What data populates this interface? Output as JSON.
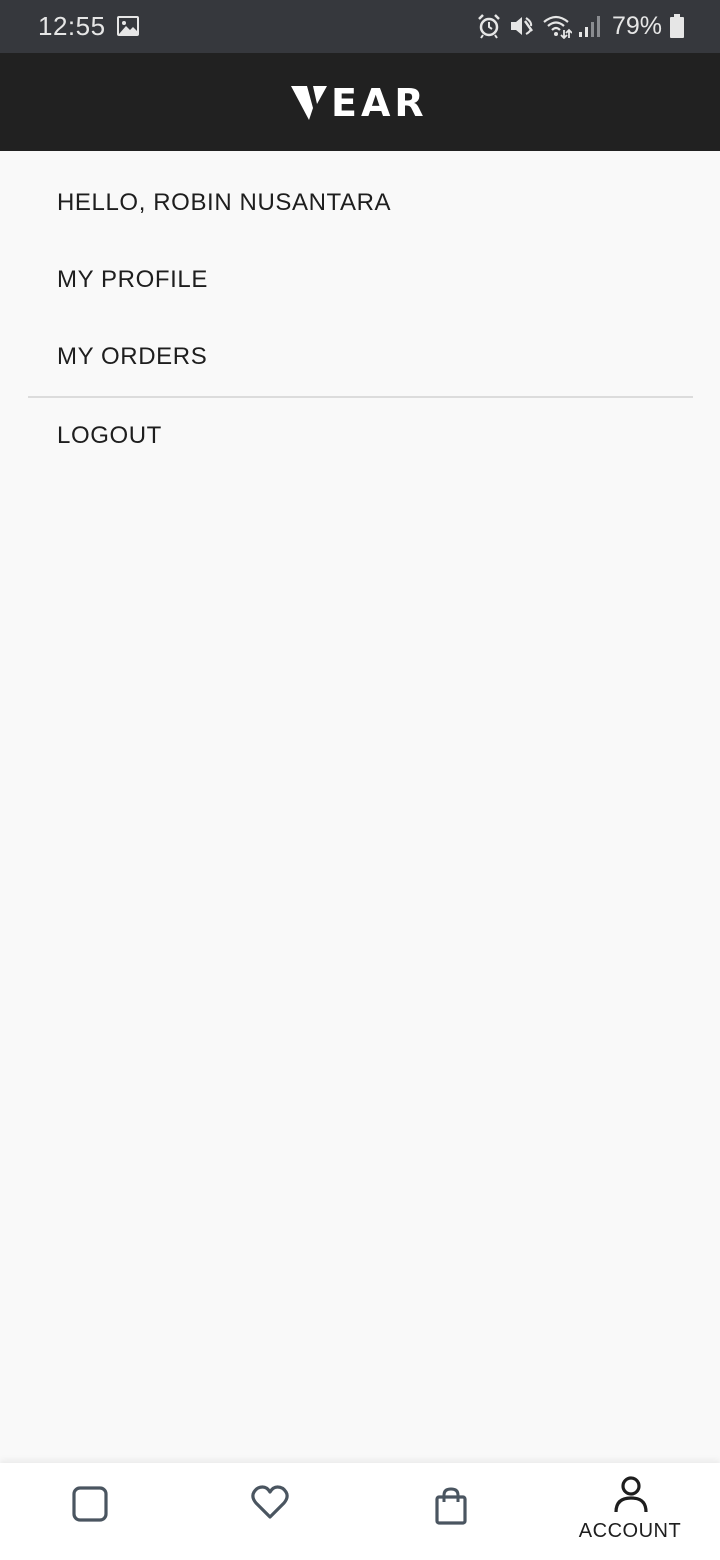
{
  "status_bar": {
    "time": "12:55",
    "battery_percent": "79%",
    "icons": [
      "image-icon",
      "alarm-icon",
      "mute-icon",
      "wifi-icon",
      "signal-icon",
      "battery-icon"
    ]
  },
  "header": {
    "logo_text": "EAR",
    "logo_name": "VEAR"
  },
  "menu": {
    "greeting": "HELLO, ROBIN NUSANTARA",
    "items": [
      {
        "label": "MY PROFILE"
      },
      {
        "label": "MY ORDERS"
      }
    ],
    "logout_label": "LOGOUT"
  },
  "bottom_nav": {
    "items": [
      {
        "icon": "square-home-icon",
        "label": ""
      },
      {
        "icon": "heart-icon",
        "label": ""
      },
      {
        "icon": "shopping-bag-icon",
        "label": ""
      },
      {
        "icon": "person-icon",
        "label": "ACCOUNT",
        "active": true
      }
    ],
    "icon_color": "#4a5560",
    "active_color": "#1e1e1e"
  },
  "colors": {
    "status_bar_bg": "#36383d",
    "header_bg": "#212121",
    "page_bg": "#f9f9f9",
    "divider": "#dcdcdc"
  }
}
